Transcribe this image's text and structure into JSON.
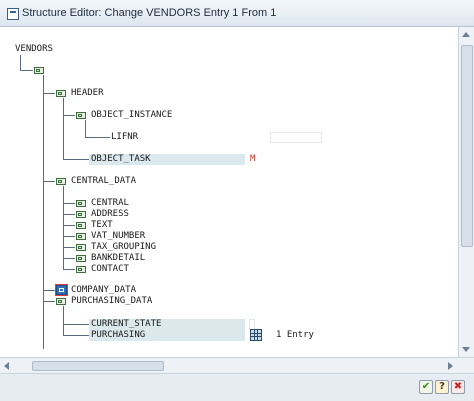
{
  "window": {
    "title": "Structure Editor: Change VENDORS Entry 1 From 1"
  },
  "tree": {
    "root": "VENDORS",
    "header": "HEADER",
    "object_instance": "OBJECT_INSTANCE",
    "lifnr": "LIFNR",
    "object_task": "OBJECT_TASK",
    "object_task_marker": "M",
    "central_data": "CENTRAL_DATA",
    "central_children": [
      "CENTRAL",
      "ADDRESS",
      "TEXT",
      "VAT_NUMBER",
      "TAX_GROUPING",
      "BANKDETAIL",
      "CONTACT"
    ],
    "company_data": "COMPANY_DATA",
    "purchasing_data": "PURCHASING_DATA",
    "current_state": "CURRENT_STATE",
    "purchasing": "PURCHASING",
    "purchasing_entries": "1 Entry"
  },
  "icons": {
    "folder": "folder-node-icon",
    "selected": "selected-node-icon",
    "table": "table-icon",
    "ok": "checkmark-icon",
    "help": "help-icon",
    "cancel": "cancel-icon"
  },
  "footer": {
    "ok_symbol": "✔",
    "help_symbol": "?",
    "cancel_symbol": "✖"
  },
  "colors": {
    "field_bg": "#dbe8ec",
    "marker": "#c0392b",
    "selected": "#2f6db4"
  }
}
